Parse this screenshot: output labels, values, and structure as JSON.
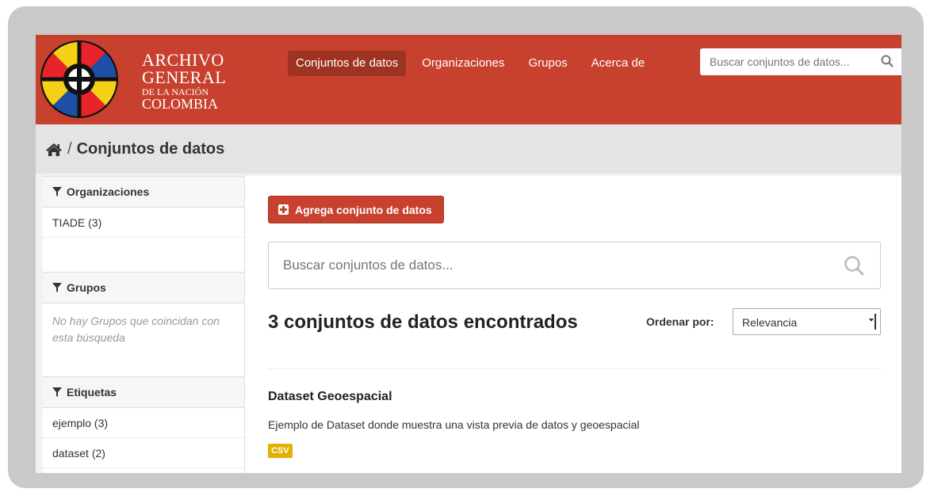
{
  "logo": {
    "line1": "ARCHIVO",
    "line2": "GENERAL",
    "line3": "DE LA NACIÓN",
    "line4": "COLOMBIA"
  },
  "nav": {
    "items": [
      {
        "label": "Conjuntos de datos",
        "active": true
      },
      {
        "label": "Organizaciones"
      },
      {
        "label": "Grupos"
      },
      {
        "label": "Acerca de"
      }
    ]
  },
  "header_search": {
    "placeholder": "Buscar conjuntos de datos..."
  },
  "breadcrumb": {
    "separator": "/",
    "current": "Conjuntos de datos"
  },
  "sidebar": {
    "organizations": {
      "heading": "Organizaciones",
      "items": [
        "TIADE (3)"
      ]
    },
    "groups": {
      "heading": "Grupos",
      "empty": "No hay Grupos que coincidan con esta búsqueda"
    },
    "tags": {
      "heading": "Etiquetas",
      "items": [
        "ejemplo (3)",
        "dataset (2)"
      ]
    }
  },
  "main": {
    "add_button": "Agrega conjunto de datos",
    "search_placeholder": "Buscar conjuntos de datos...",
    "results_title": "3 conjuntos de datos encontrados",
    "order_label": "Ordenar por:",
    "order_value": "Relevancia",
    "datasets": [
      {
        "title": "Dataset Geoespacial",
        "description": "Ejemplo de Dataset donde muestra una vista previa de datos y geoespacial",
        "format": "CSV"
      }
    ]
  },
  "colors": {
    "brand_red": "#c7412e",
    "nav_active": "#9e3322",
    "csv_badge": "#dfb100"
  }
}
